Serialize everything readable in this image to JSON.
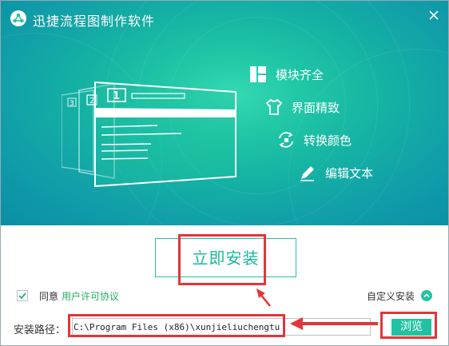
{
  "window": {
    "title": "迅捷流程图制作软件",
    "close_icon": "close-icon"
  },
  "colors": {
    "accent": "#20c2a1",
    "annotation": "#e5343a",
    "link": "#1fae5d"
  },
  "illustration": {
    "pages": [
      "1",
      "2",
      "3"
    ]
  },
  "features": [
    {
      "label": "模块齐全",
      "icon": "modules-icon"
    },
    {
      "label": "界面精致",
      "icon": "tshirt-icon"
    },
    {
      "label": "转换颜色",
      "icon": "convert-icon"
    },
    {
      "label": "编辑文本",
      "icon": "pen-icon"
    }
  ],
  "install": {
    "button_label": "立即安装"
  },
  "agreement": {
    "checked": true,
    "prefix": "同意",
    "link_label": "用户许可协议"
  },
  "custom_install": {
    "label": "自定义安装",
    "icon": "chevron-up-icon"
  },
  "path": {
    "label": "安装路径：",
    "value": "C:\\Program Files (x86)\\xunjieliuchengtu"
  },
  "browse": {
    "label": "浏览"
  }
}
